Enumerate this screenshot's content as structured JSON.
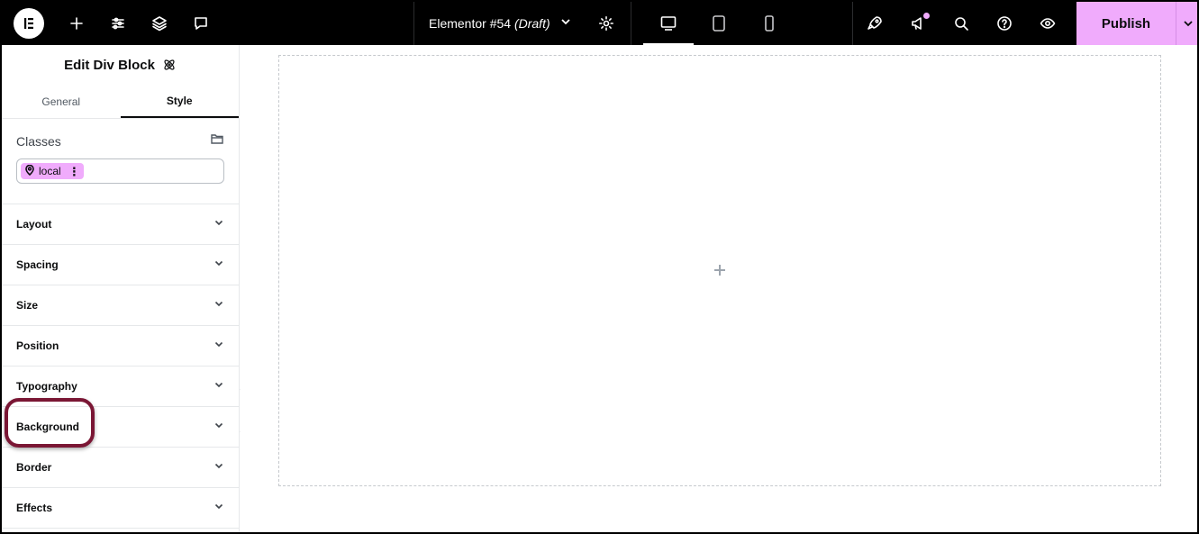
{
  "topbar": {
    "logo_label": "Elementor",
    "document_name": "Elementor #54",
    "document_status": "(Draft)",
    "publish_label": "Publish",
    "accent_color": "#f0abfc",
    "left_icons": [
      "plus-icon",
      "sliders-icon",
      "layers-icon",
      "comment-icon"
    ],
    "devices": [
      {
        "name": "desktop",
        "active": true
      },
      {
        "name": "tablet",
        "active": false
      },
      {
        "name": "mobile",
        "active": false
      }
    ],
    "right_icons": [
      "rocket-icon",
      "megaphone-icon",
      "search-icon",
      "help-icon",
      "eye-icon"
    ]
  },
  "panel": {
    "title": "Edit Div Block",
    "tabs": [
      {
        "label": "General",
        "active": false
      },
      {
        "label": "Style",
        "active": true
      }
    ],
    "classes": {
      "label": "Classes",
      "chip_label": "local",
      "chip_menu": "⋮"
    },
    "sections": [
      {
        "label": "Layout"
      },
      {
        "label": "Spacing"
      },
      {
        "label": "Size"
      },
      {
        "label": "Position"
      },
      {
        "label": "Typography"
      },
      {
        "label": "Background",
        "highlighted": true
      },
      {
        "label": "Border"
      },
      {
        "label": "Effects"
      }
    ]
  },
  "canvas": {
    "add_label": "+"
  }
}
